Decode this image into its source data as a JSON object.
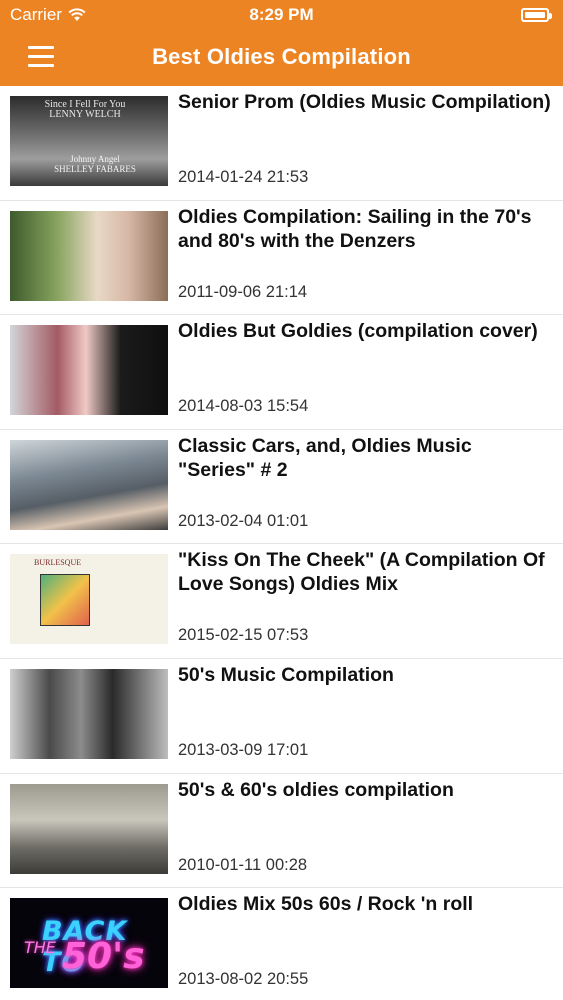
{
  "status_bar": {
    "carrier": "Carrier",
    "time": "8:29 PM"
  },
  "nav": {
    "title": "Best Oldies Compilation",
    "menu_icon": "hamburger-menu-icon"
  },
  "colors": {
    "header": "#ec8424",
    "text": "#111111",
    "divider": "#e4e4e4"
  },
  "videos": [
    {
      "title": "Senior Prom (Oldies Music Compilation)",
      "date": "2014-01-24 21:53",
      "thumb_text_top": "Since I Fell For You\nLENNY WELCH",
      "thumb_text_bottom": "Johnny Angel\nSHELLEY FABARES"
    },
    {
      "title": "Oldies Compilation: Sailing in the 70's and 80's with the Denzers",
      "date": "2011-09-06 21:14"
    },
    {
      "title": "Oldies But Goldies (compilation cover)",
      "date": "2014-08-03 15:54"
    },
    {
      "title": "Classic Cars, and, Oldies Music \"Series\"  # 2",
      "date": "2013-02-04 01:01"
    },
    {
      "title": "\"Kiss On The Cheek\" (A Compilation Of Love Songs) Oldies Mix",
      "date": "2015-02-15 07:53",
      "thumb_text_top": "BURLESQUE"
    },
    {
      "title": "50's Music Compilation",
      "date": "2013-03-09 17:01"
    },
    {
      "title": "50's & 60's oldies compilation",
      "date": "2010-01-11 00:28"
    },
    {
      "title": "Oldies Mix 50s 60s / Rock 'n roll",
      "date": "2013-08-02 20:55",
      "thumb_text_back": "BACK TO",
      "thumb_text_the": "THE",
      "thumb_text_50s": "50's"
    }
  ]
}
